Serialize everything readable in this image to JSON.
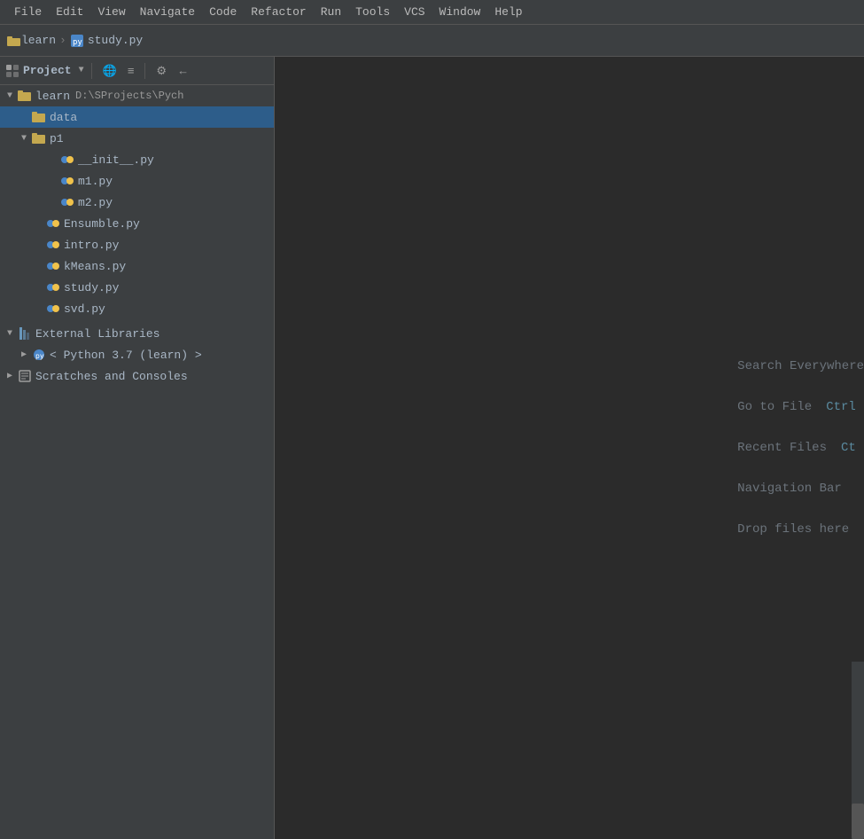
{
  "menubar": {
    "items": [
      "File",
      "Edit",
      "View",
      "Navigate",
      "Code",
      "Refactor",
      "Run",
      "Tools",
      "VCS",
      "Window",
      "Help"
    ]
  },
  "tabbar": {
    "breadcrumb_folder": "learn",
    "breadcrumb_file": "study.py",
    "tab_label": "study.py"
  },
  "sidebar": {
    "toolbar": {
      "label": "Project",
      "buttons": [
        "🌐",
        "≡",
        "⚙",
        "←"
      ]
    },
    "tree": {
      "root": {
        "label": "learn",
        "path": "D:\\SProjects\\Pych",
        "expanded": true
      },
      "items": [
        {
          "id": "data",
          "label": "data",
          "type": "folder",
          "indent": 1,
          "selected": true
        },
        {
          "id": "p1",
          "label": "p1",
          "type": "folder",
          "indent": 1,
          "expanded": true
        },
        {
          "id": "init",
          "label": "__init__.py",
          "type": "pyfile",
          "indent": 3
        },
        {
          "id": "m1",
          "label": "m1.py",
          "type": "pyfile",
          "indent": 3
        },
        {
          "id": "m2",
          "label": "m2.py",
          "type": "pyfile",
          "indent": 3
        },
        {
          "id": "ensumble",
          "label": "Ensumble.py",
          "type": "pyfile",
          "indent": 2
        },
        {
          "id": "intro",
          "label": "intro.py",
          "type": "pyfile",
          "indent": 2
        },
        {
          "id": "kmeans",
          "label": "kMeans.py",
          "type": "pyfile",
          "indent": 2
        },
        {
          "id": "study",
          "label": "study.py",
          "type": "pyfile",
          "indent": 2
        },
        {
          "id": "svd",
          "label": "svd.py",
          "type": "pyfile",
          "indent": 2
        }
      ],
      "external_libraries": {
        "label": "External Libraries",
        "expanded": true,
        "children": [
          {
            "label": "< Python 3.7 (learn) >",
            "type": "python"
          }
        ]
      },
      "scratches": {
        "label": "Scratches and Consoles",
        "expanded": false
      }
    }
  },
  "editor": {
    "hints": [
      {
        "text": "Search Everywhere",
        "shortcut": "",
        "shortcut_key": ""
      },
      {
        "text": "Go to File",
        "shortcut": "Ctrl",
        "shortcut_key": "Ctrl"
      },
      {
        "text": "Recent Files",
        "shortcut": "Ct",
        "shortcut_key": "Ct"
      },
      {
        "text": "Navigation Bar",
        "shortcut": "",
        "shortcut_key": ""
      },
      {
        "text": "Drop files here",
        "shortcut": "",
        "shortcut_key": ""
      }
    ]
  }
}
